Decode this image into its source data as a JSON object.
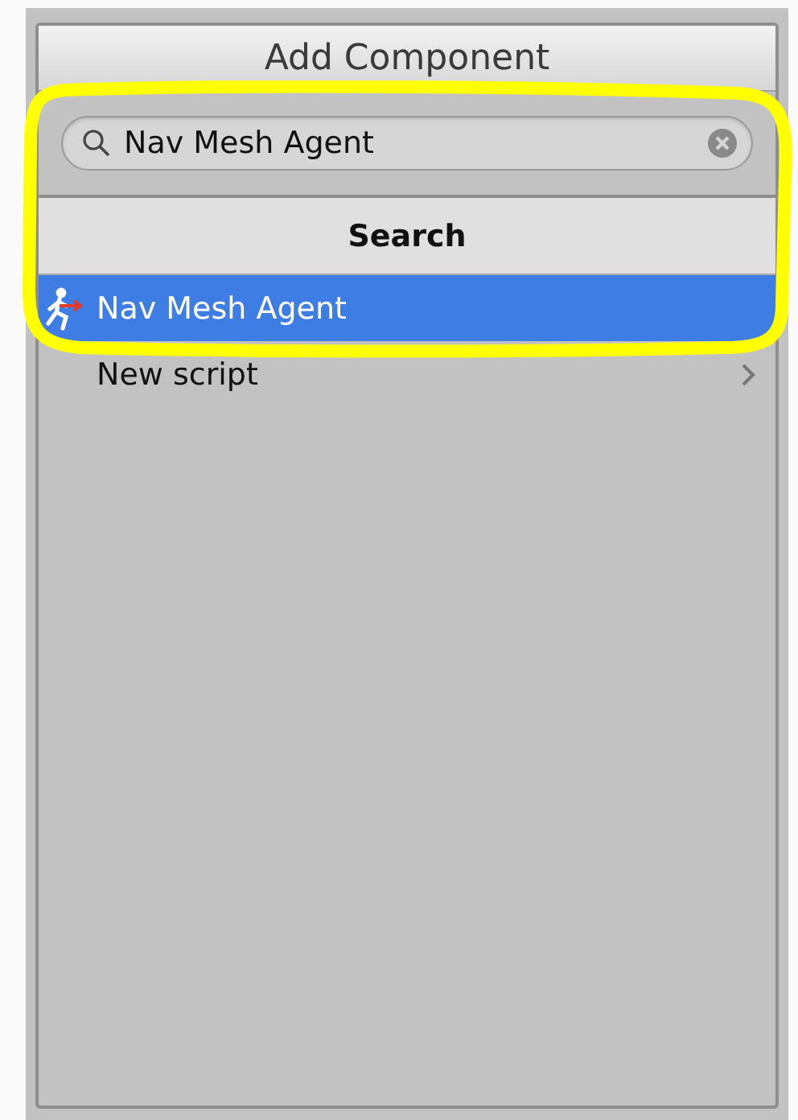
{
  "window": {
    "title": "Add Component"
  },
  "search": {
    "value": "Nav Mesh Agent"
  },
  "section": {
    "title": "Search"
  },
  "items": [
    {
      "label": "Nav Mesh Agent",
      "selected": true,
      "kind": "component"
    },
    {
      "label": "New script",
      "selected": false,
      "kind": "submenu"
    }
  ],
  "annotation": {
    "kind": "highlight"
  }
}
